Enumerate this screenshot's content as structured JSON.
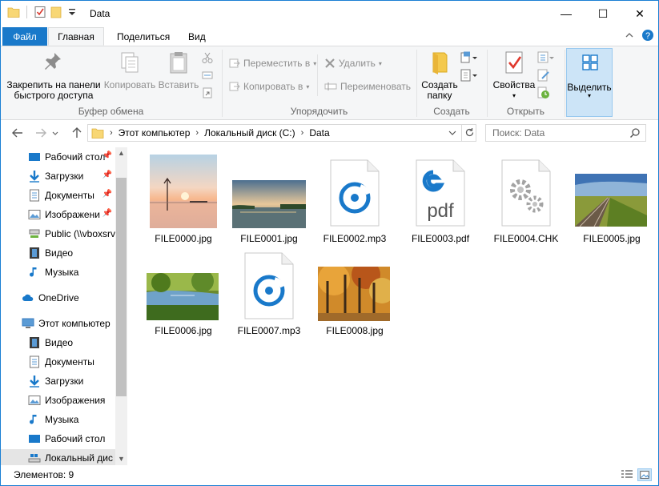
{
  "window": {
    "title": "Data",
    "controls": {
      "minimize": "—",
      "maximize": "☐",
      "close": "✕"
    }
  },
  "ribbon_tabs": {
    "file": "Файл",
    "home": "Главная",
    "share": "Поделиться",
    "view": "Вид"
  },
  "ribbon": {
    "clipboard": {
      "label": "Буфер обмена",
      "pin_line1": "Закрепить на панели",
      "pin_line2": "быстрого доступа",
      "copy": "Копировать",
      "paste": "Вставить"
    },
    "organize": {
      "label": "Упорядочить",
      "move_to": "Переместить в",
      "copy_to": "Копировать в",
      "delete": "Удалить",
      "rename": "Переименовать"
    },
    "new": {
      "label": "Создать",
      "new_folder_line1": "Создать",
      "new_folder_line2": "папку"
    },
    "open": {
      "label": "Открыть",
      "properties": "Свойства"
    },
    "select": {
      "label": "Выделить"
    }
  },
  "address": {
    "crumbs": [
      "Этот компьютер",
      "Локальный диск (C:)",
      "Data"
    ]
  },
  "search": {
    "placeholder": "Поиск: Data"
  },
  "nav": {
    "quick_access": [
      {
        "label": "Рабочий стол",
        "pinned": true
      },
      {
        "label": "Загрузки",
        "pinned": true
      },
      {
        "label": "Документы",
        "pinned": true
      },
      {
        "label": "Изображени",
        "pinned": true
      },
      {
        "label": "Public (\\\\vboxsrv",
        "pinned": false
      },
      {
        "label": "Видео",
        "pinned": false
      },
      {
        "label": "Музыка",
        "pinned": false
      }
    ],
    "onedrive": "OneDrive",
    "this_pc": "Этот компьютер",
    "this_pc_items": [
      "Видео",
      "Документы",
      "Загрузки",
      "Изображения",
      "Музыка",
      "Рабочий стол",
      "Локальный дис"
    ]
  },
  "files": [
    {
      "name": "FILE0000.jpg",
      "kind": "photo-sunset-icon"
    },
    {
      "name": "FILE0001.jpg",
      "kind": "photo-lake-icon"
    },
    {
      "name": "FILE0002.mp3",
      "kind": "audio-file-icon"
    },
    {
      "name": "FILE0003.pdf",
      "kind": "pdf-file-icon"
    },
    {
      "name": "FILE0004.CHK",
      "kind": "system-file-icon"
    },
    {
      "name": "FILE0005.jpg",
      "kind": "photo-railway-icon"
    },
    {
      "name": "FILE0006.jpg",
      "kind": "photo-pond-icon"
    },
    {
      "name": "FILE0007.mp3",
      "kind": "audio-file-icon"
    },
    {
      "name": "FILE0008.jpg",
      "kind": "photo-autumn-icon"
    }
  ],
  "pdf_icon_text": "pdf",
  "status": {
    "items_count": "Элементов: 9"
  },
  "colors": {
    "accent": "#1979ca",
    "ribbon_bg": "#f5f6f7",
    "selected_bg": "#cce4f7"
  }
}
